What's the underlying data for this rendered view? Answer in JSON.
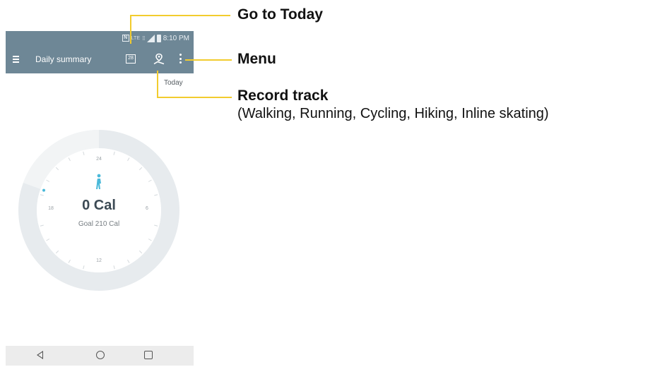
{
  "status_bar": {
    "nfc_label": "N",
    "network": "LTE",
    "time": "8:10 PM"
  },
  "app_bar": {
    "title": "Daily summary",
    "calendar_day": "28"
  },
  "date_label": "Today",
  "dial": {
    "calories": "0 Cal",
    "goal": "Goal 210 Cal",
    "ticks": {
      "top": "24",
      "right": "6",
      "bottom": "12",
      "left": "18"
    },
    "progress_fraction": 0.0,
    "ring_color": "#e7ebee",
    "accent_color": "#4ab9d9"
  },
  "callouts": {
    "go_to_today": "Go to Today",
    "menu": "Menu",
    "record_track": "Record track",
    "record_track_sub": "(Walking, Running, Cycling, Hiking, Inline skating)"
  },
  "colors": {
    "app_bar": "#6e8796",
    "callout_line": "#f2cc2e"
  },
  "icons": {
    "nav": [
      "hamburger-icon",
      "calendar-icon",
      "record-track-icon",
      "menu-icon"
    ],
    "system_nav": [
      "back-icon",
      "home-icon",
      "recents-icon"
    ]
  }
}
